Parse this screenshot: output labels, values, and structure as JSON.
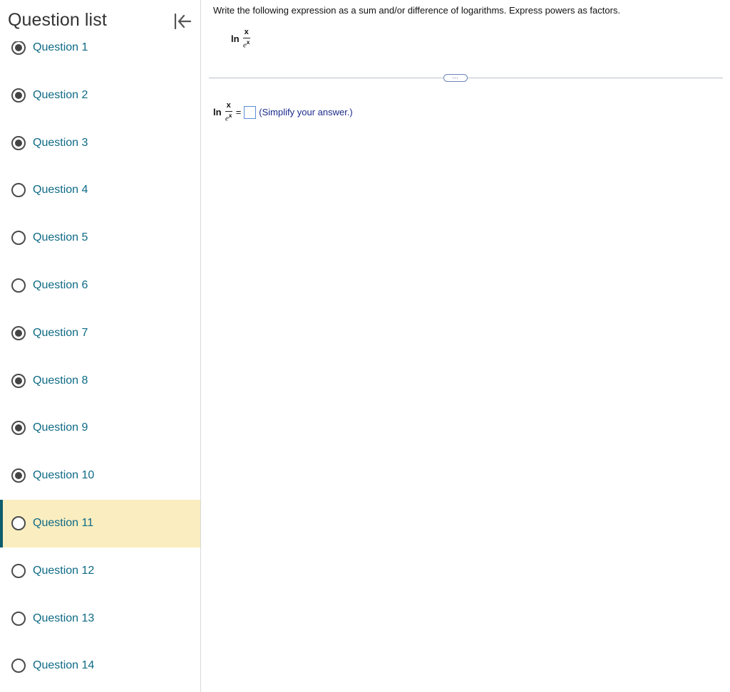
{
  "sidebar": {
    "title": "Question list",
    "collapse_icon": "collapse-left-icon",
    "questions": [
      {
        "label": "Question 1",
        "state": "answered"
      },
      {
        "label": "Question 2",
        "state": "answered"
      },
      {
        "label": "Question 3",
        "state": "answered"
      },
      {
        "label": "Question 4",
        "state": "unanswered"
      },
      {
        "label": "Question 5",
        "state": "unanswered"
      },
      {
        "label": "Question 6",
        "state": "unanswered"
      },
      {
        "label": "Question 7",
        "state": "answered"
      },
      {
        "label": "Question 8",
        "state": "answered"
      },
      {
        "label": "Question 9",
        "state": "answered"
      },
      {
        "label": "Question 10",
        "state": "answered"
      },
      {
        "label": "Question 11",
        "state": "current"
      },
      {
        "label": "Question 12",
        "state": "unanswered"
      },
      {
        "label": "Question 13",
        "state": "unanswered"
      },
      {
        "label": "Question 14",
        "state": "unanswered"
      }
    ]
  },
  "problem": {
    "instructions": "Write the following expression as a sum and/or difference of logarithms. Express powers as factors.",
    "expression": {
      "function": "ln",
      "numerator": "x",
      "denominator_base": "e",
      "denominator_exponent": "x"
    },
    "divider_handle_label": "…",
    "answer": {
      "equals": "=",
      "value": "",
      "hint": "(Simplify your answer.)"
    }
  },
  "colors": {
    "link": "#0e6a85",
    "active_row": "#faedc0",
    "active_bar": "#0e5c6e",
    "hint": "#1a2a8a",
    "answer_border": "#5b8fd6"
  }
}
